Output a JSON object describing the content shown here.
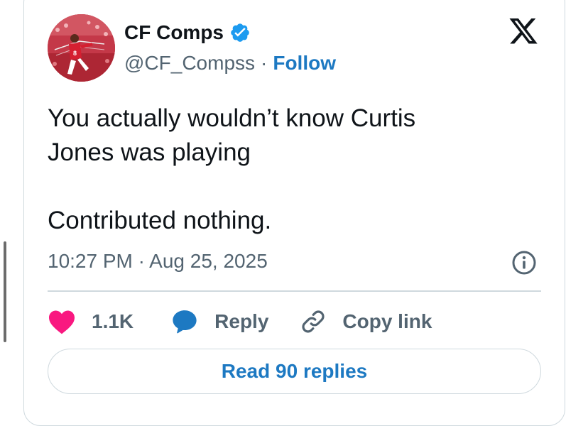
{
  "author": {
    "name": "CF Comps",
    "handle": "@CF_Compss",
    "separator": "·",
    "follow_label": "Follow",
    "verified_icon": "verified-badge-icon",
    "avatar_icon": "football-player-avatar"
  },
  "tweet": {
    "lines": [
      "You actually wouldn’t know Curtis",
      "Jones was playing",
      "Contributed nothing."
    ],
    "timestamp": "10:27 PM · Aug 25, 2025"
  },
  "actions": {
    "likes_count": "1.1K",
    "reply_label": "Reply",
    "copy_link_label": "Copy link"
  },
  "read_replies_label": "Read 90 replies",
  "colors": {
    "accent": "#1d79c2",
    "verified": "#1d9bf0",
    "heart": "#f91880",
    "muted_text": "#536471",
    "border": "#cfd9de"
  },
  "icons": {
    "brand": "x-logo-icon",
    "info": "info-icon",
    "like": "heart-icon",
    "reply": "speech-bubble-icon",
    "copy_link": "link-icon"
  }
}
